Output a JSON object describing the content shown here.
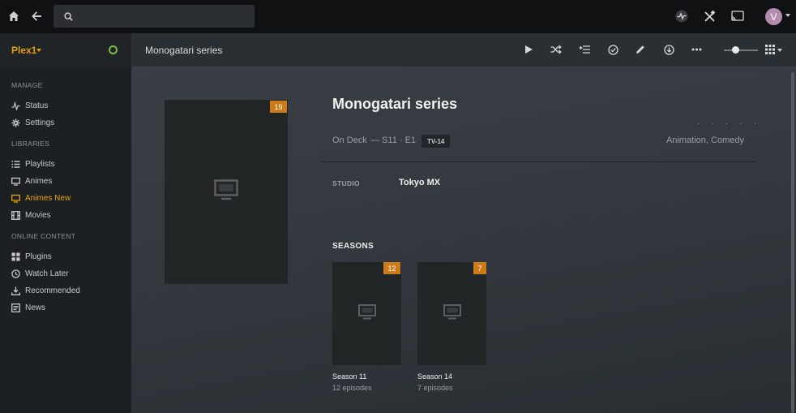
{
  "topbar": {
    "icons": [
      "home-icon",
      "back-icon",
      "search-icon",
      "activity-icon",
      "tools-icon",
      "cast-icon"
    ],
    "search_placeholder": "",
    "avatar_letter": "V"
  },
  "sidebar": {
    "server_name": "Plex1",
    "sections": {
      "manage": "MANAGE",
      "libraries": "LIBRARIES",
      "online": "ONLINE CONTENT"
    },
    "items": [
      {
        "label": "Status",
        "icon": "activity-icon"
      },
      {
        "label": "Settings",
        "icon": "gear-icon"
      },
      {
        "label": "Playlists",
        "icon": "list-icon"
      },
      {
        "label": "Animes",
        "icon": "monitor-icon"
      },
      {
        "label": "Animes New",
        "icon": "monitor-icon",
        "active": true
      },
      {
        "label": "Movies",
        "icon": "film-icon"
      },
      {
        "label": "Plugins",
        "icon": "grid-icon"
      },
      {
        "label": "Watch Later",
        "icon": "clock-icon"
      },
      {
        "label": "Recommended",
        "icon": "download-icon"
      },
      {
        "label": "News",
        "icon": "newspaper-icon"
      }
    ]
  },
  "toolbar": {
    "title": "Monogatari series",
    "actions": [
      "play-icon",
      "shuffle-icon",
      "add-to-queue-icon",
      "mark-watched-icon",
      "edit-icon",
      "download-icon",
      "more-icon"
    ]
  },
  "series": {
    "title": "Monogatari series",
    "unwatched_count": "19",
    "on_deck": "On Deck",
    "on_deck_episode": "— S11 · E1",
    "content_rating": "TV-14",
    "genres": "Animation, Comedy",
    "rating_dots": "· · · · ·",
    "studio_label": "STUDIO",
    "studio": "Tokyo MX"
  },
  "seasons": {
    "title": "SEASONS",
    "items": [
      {
        "name": "Season 11",
        "episodes": "12 episodes",
        "badge": "12"
      },
      {
        "name": "Season 14",
        "episodes": "7 episodes",
        "badge": "7"
      }
    ]
  },
  "colors": {
    "accent": "#e5a00d",
    "badge": "#cc7b19",
    "status_ok": "#7bc043"
  }
}
